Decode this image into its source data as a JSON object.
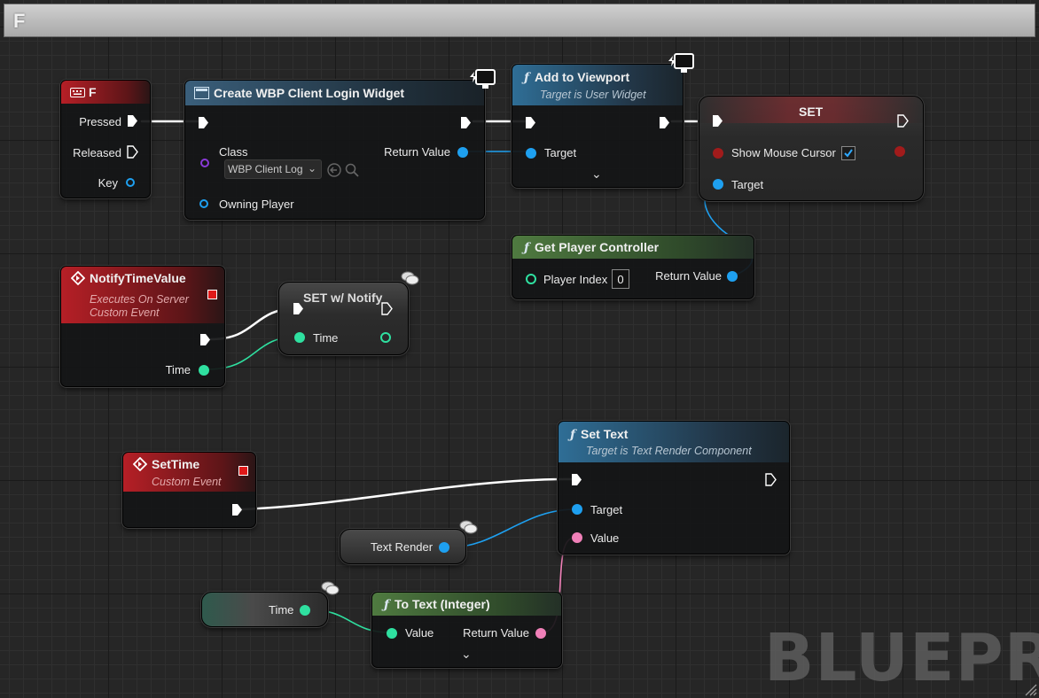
{
  "window": {
    "title": "F"
  },
  "nodes": {
    "f_event": {
      "title": "F",
      "pressed": "Pressed",
      "released": "Released",
      "key": "Key"
    },
    "create_widget": {
      "title": "Create WBP Client Login Widget",
      "class_label": "Class",
      "class_value": "WBP Client Log",
      "return_value": "Return Value",
      "owning_player": "Owning Player"
    },
    "add_viewport": {
      "title": "Add to Viewport",
      "subtitle": "Target is User Widget",
      "target": "Target"
    },
    "set_cursor": {
      "title": "SET",
      "show_mouse_cursor": "Show Mouse Cursor",
      "target": "Target",
      "checked": true
    },
    "get_pc": {
      "title": "Get Player Controller",
      "player_index": "Player Index",
      "player_index_value": "0",
      "return_value": "Return Value"
    },
    "notify_event": {
      "title": "NotifyTimeValue",
      "subtitle1": "Executes On Server",
      "subtitle2": "Custom Event",
      "time": "Time"
    },
    "set_notify": {
      "title": "SET w/ Notify",
      "time": "Time"
    },
    "settime_event": {
      "title": "SetTime",
      "subtitle": "Custom Event"
    },
    "set_text": {
      "title": "Set Text",
      "subtitle": "Target is Text Render Component",
      "target": "Target",
      "value": "Value"
    },
    "text_render": {
      "label": "Text Render"
    },
    "time_var": {
      "label": "Time"
    },
    "to_text": {
      "title": "To Text (Integer)",
      "value": "Value",
      "return_value": "Return Value"
    }
  },
  "watermark": "BLUEPRINT",
  "colors": {
    "exec": "#ffffff",
    "object": "#1ea0f0",
    "float": "#2fe0a0",
    "text": "#f080b8",
    "class": "#8a3ad8",
    "bool": "#a11b1b"
  }
}
